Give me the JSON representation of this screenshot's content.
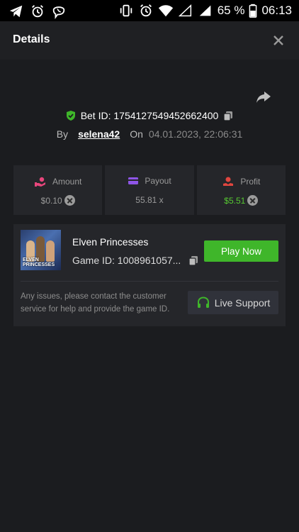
{
  "status_bar": {
    "battery_percent": "65 %",
    "time": "06:13",
    "left_icons": [
      "telegram-icon",
      "alarm-icon",
      "viber-icon"
    ],
    "right_icons": [
      "vibrate-icon",
      "alarm-icon",
      "wifi-icon",
      "signal-empty-icon",
      "signal-icon",
      "battery-icon"
    ]
  },
  "header": {
    "title": "Details",
    "close_icon": "close-icon"
  },
  "bet": {
    "label": "Bet ID: 1754127549452662400",
    "by_label": "By",
    "username": "selena42",
    "on_label": "On",
    "date": "04.01.2023, 22:06:31"
  },
  "stats": [
    {
      "label": "Amount",
      "value": "$0.10",
      "icon": "amount-icon",
      "accent": "#e8467c"
    },
    {
      "label": "Payout",
      "value": "55.81 x",
      "icon": "payout-icon",
      "accent": "#8e55e6"
    },
    {
      "label": "Profit",
      "value": "$5.51",
      "icon": "profit-icon",
      "accent": "#e0463f"
    }
  ],
  "game": {
    "name": "Elven Princesses",
    "thumbnail_text": "ELVEN PRINCESSES",
    "id_label": "Game ID: 1008961057...",
    "play_label": "Play Now"
  },
  "support": {
    "text": "Any issues, please contact the customer service for help and provide the game ID.",
    "button_label": "Live Support"
  },
  "colors": {
    "accent_green": "#3fb62a",
    "profit_green": "#56c832",
    "background": "#1b1c1f",
    "card": "#25262a"
  }
}
